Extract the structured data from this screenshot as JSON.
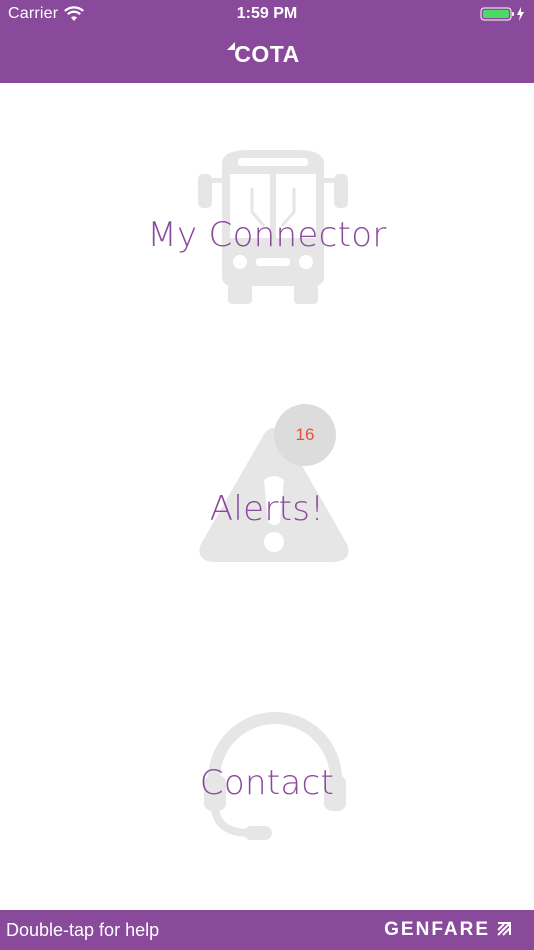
{
  "status_bar": {
    "carrier": "Carrier",
    "time": "1:59 PM",
    "wifi_icon": "wifi-icon",
    "battery_icon": "battery-charging-icon",
    "battery_color": "#4cd964"
  },
  "nav": {
    "logo": "COTA",
    "background": "#8a4a9c"
  },
  "menu": {
    "my_connector": {
      "label": "My Connector",
      "icon": "bus-icon"
    },
    "alerts": {
      "label": "Alerts!",
      "icon": "warning-icon",
      "badge_count": "16"
    },
    "contact": {
      "label": "Contact",
      "icon": "headset-icon"
    }
  },
  "footer": {
    "help_text": "Double-tap for help",
    "brand": "GENFARE",
    "brand_icon": "genfare-arrow-icon"
  },
  "colors": {
    "accent": "#8a4a9c",
    "icon_gray": "#e6e6e6",
    "badge_bg": "#dcdcdc",
    "badge_text": "#e8503c"
  }
}
